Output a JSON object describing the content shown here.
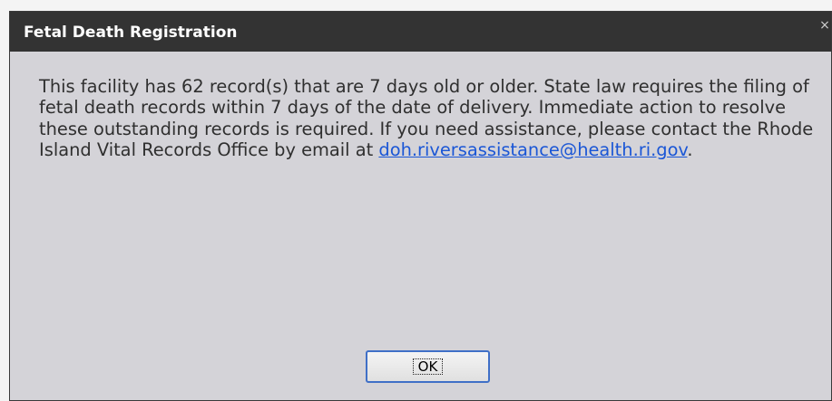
{
  "dialog": {
    "title": "Fetal Death Registration",
    "close_glyph": "×",
    "message_text": "This facility has 62 record(s) that are 7 days old or older. State law requires the filing of fetal death records within 7 days of the date of delivery. Immediate action to resolve these outstanding records is required. If you need assistance, please contact the Rhode Island Vital Records Office by email at ",
    "email_link": "doh.riversassistance@health.ri.gov",
    "message_end": ".",
    "ok_label": "OK"
  },
  "colors": {
    "titlebar": "#333333",
    "dialog_body": "#d4d3d8",
    "link": "#1a56d6",
    "button_border": "#3f6fc7"
  },
  "icons": {
    "close": "close-icon"
  }
}
